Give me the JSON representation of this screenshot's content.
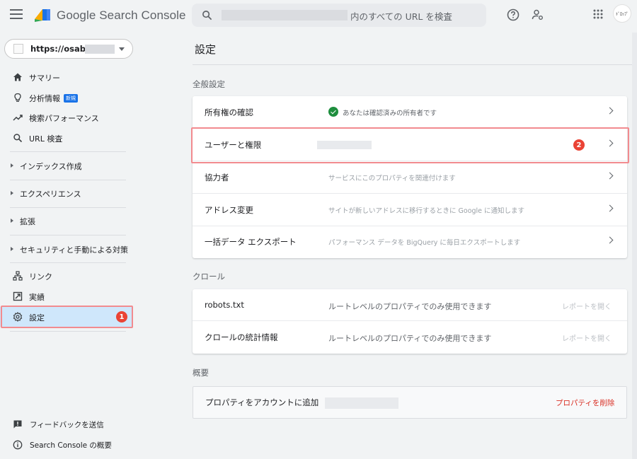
{
  "header": {
    "app_name": "Google Search Console",
    "search_placeholder_suffix": "内のすべての URL を検査",
    "avatar_text": "ﾄﾞﾛｯﾌﾟ"
  },
  "sidebar": {
    "property": "https://osaboo",
    "nav": [
      {
        "label": "サマリー",
        "icon": "home-icon"
      },
      {
        "label": "分析情報",
        "badge": "新規",
        "icon": "lightbulb-icon"
      },
      {
        "label": "検索パフォーマンス",
        "icon": "trending-icon"
      },
      {
        "label": "URL 検査",
        "icon": "search-icon"
      }
    ],
    "groups": [
      "インデックス作成",
      "エクスペリエンス",
      "拡張",
      "セキュリティと手動による対策"
    ],
    "tools": [
      {
        "label": "リンク",
        "icon": "links-icon"
      },
      {
        "label": "実績",
        "icon": "achievements-icon"
      },
      {
        "label": "設定",
        "icon": "settings-icon",
        "active": true,
        "step": "1"
      }
    ],
    "bottom": [
      {
        "label": "フィードバックを送信",
        "icon": "feedback-icon"
      },
      {
        "label": "Search Console の概要",
        "icon": "info-icon"
      }
    ]
  },
  "main": {
    "title": "設定",
    "general": {
      "heading": "全般設定",
      "rows": [
        {
          "label": "所有権の確認",
          "desc": "あなたは確認済みの所有者です"
        },
        {
          "label": "ユーザーと権限",
          "step": "2"
        },
        {
          "label": "協力者",
          "desc": "サービスにこのプロパティを関連付けます"
        },
        {
          "label": "アドレス変更",
          "desc": "サイトが新しいアドレスに移行するときに Google に通知します"
        },
        {
          "label": "一括データ エクスポート",
          "desc": "パフォーマンス データを BigQuery に毎日エクスポートします"
        }
      ]
    },
    "crawl": {
      "heading": "クロール",
      "rows": [
        {
          "label": "robots.txt",
          "desc": "ルートレベルのプロパティでのみ使用できます",
          "link": "レポートを開く"
        },
        {
          "label": "クロールの統計情報",
          "desc": "ルートレベルのプロパティでのみ使用できます",
          "link": "レポートを開く"
        }
      ]
    },
    "about": {
      "heading": "概要",
      "label": "プロパティをアカウントに追加",
      "delete": "プロパティを削除"
    }
  },
  "colors": {
    "accent": "#1a73e8",
    "highlight": "#f28b8f",
    "step": "#ea4335",
    "delete": "#d93025",
    "success": "#1e8e3e"
  }
}
